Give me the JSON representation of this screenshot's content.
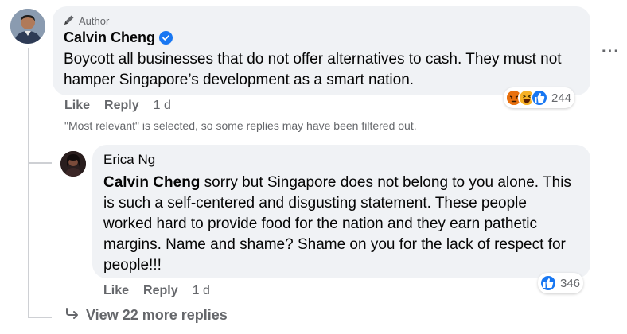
{
  "comment": {
    "author_badge": "Author",
    "author_name": "Calvin Cheng",
    "text": "Boycott all businesses that do not offer alternatives to cash. They must not hamper Singapore’s development as a smart nation.",
    "like_label": "Like",
    "reply_label": "Reply",
    "timestamp": "1 d",
    "reaction_count": "244",
    "reaction_icons": [
      "angry-icon",
      "haha-icon",
      "like-icon"
    ]
  },
  "filter_note": "\"Most relevant\" is selected, so some replies may have been filtered out.",
  "reply": {
    "author_name": "Erica Ng",
    "tag": "Calvin Cheng",
    "text": " sorry but Singapore does not belong to you alone. This is such a self-centered and disgusting statement. These people worked hard to provide food for the nation and they earn pathetic margins. Name and shame? Shame on you for the lack of respect for people!!!",
    "like_label": "Like",
    "reply_label": "Reply",
    "timestamp": "1 d",
    "reaction_count": "346",
    "reaction_icons": [
      "like-icon"
    ]
  },
  "more_options": "···",
  "view_more": "View 22 more replies",
  "colors": {
    "bubble": "#f0f2f5",
    "secondary_text": "#65676b",
    "like_blue": "#1877f2",
    "angry": "#e9710f",
    "haha": "#f7b125"
  }
}
